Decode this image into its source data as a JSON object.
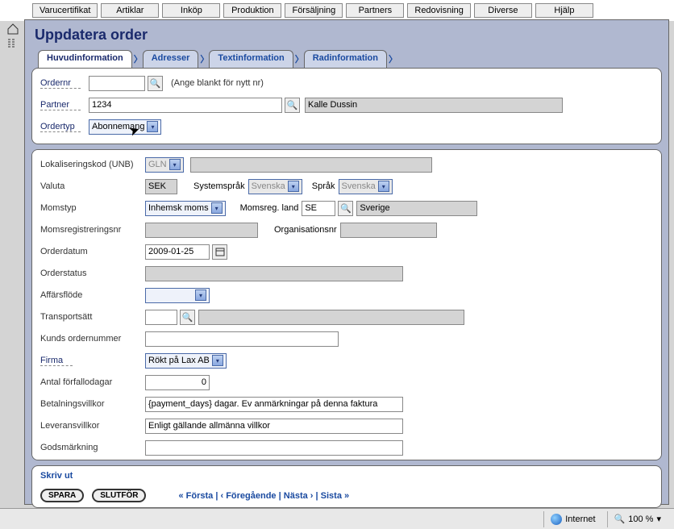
{
  "top_menu": [
    "Varucertifikat",
    "Artiklar",
    "Inköp",
    "Produktion",
    "Försäljning",
    "Partners",
    "Redovisning",
    "Diverse",
    "Hjälp"
  ],
  "page_title": "Uppdatera order",
  "tabs": [
    "Huvudinformation",
    "Adresser",
    "Textinformation",
    "Radinformation"
  ],
  "labels": {
    "ordernr": "Ordernr",
    "partner": "Partner",
    "ordertyp": "Ordertyp",
    "lokaliseringskod": "Lokaliseringskod (UNB)",
    "valuta": "Valuta",
    "systemsprak": "Systemspråk",
    "sprak": "Språk",
    "momstyp": "Momstyp",
    "momsreg_land": "Momsreg. land",
    "momsregistreringsnr": "Momsregistreringsnr",
    "organisationsnr": "Organisationsnr",
    "orderdatum": "Orderdatum",
    "orderstatus": "Orderstatus",
    "affarsflode": "Affärsflöde",
    "transportsatt": "Transportsätt",
    "kunds_ordernummer": "Kunds ordernummer",
    "firma": "Firma",
    "antal_forfallodagar": "Antal förfallodagar",
    "betalningsvillkor": "Betalningsvillkor",
    "leveransvillkor": "Leveransvillkor",
    "godsmarkning": "Godsmärkning",
    "ordernr_hint": "(Ange blankt för nytt nr)"
  },
  "values": {
    "ordernr": "",
    "partner": "1234",
    "partner_name": "Kalle Dussin",
    "ordertyp": "Abonnemang",
    "lokaliseringskod_type": "GLN",
    "lokaliseringskod": "",
    "valuta": "SEK",
    "systemsprak": "Svenska",
    "sprak": "Svenska",
    "momstyp": "Inhemsk moms",
    "momsreg_land_code": "SE",
    "momsreg_land": "Sverige",
    "momsregistreringsnr": "",
    "organisationsnr": "",
    "orderdatum": "2009-01-25",
    "orderstatus": "",
    "affarsflode": "",
    "transportsatt_code": "",
    "transportsatt": "",
    "kunds_ordernummer": "",
    "firma": "Rökt på Lax AB",
    "antal_forfallodagar": "0",
    "betalningsvillkor": "{payment_days} dagar. Ev anmärkningar på denna faktura",
    "leveransvillkor": "Enligt gällande allmänna villkor",
    "godsmarkning": ""
  },
  "bottom": {
    "skriv_ut": "Skriv ut",
    "spara": "SPARA",
    "slutfor": "SLUTFÖR",
    "forsta": "« Första",
    "foregaende": "‹ Föregående",
    "nasta": "Nästa ›",
    "sista": "Sista »"
  },
  "status": {
    "zone": "Internet",
    "zoom": "100 %"
  }
}
